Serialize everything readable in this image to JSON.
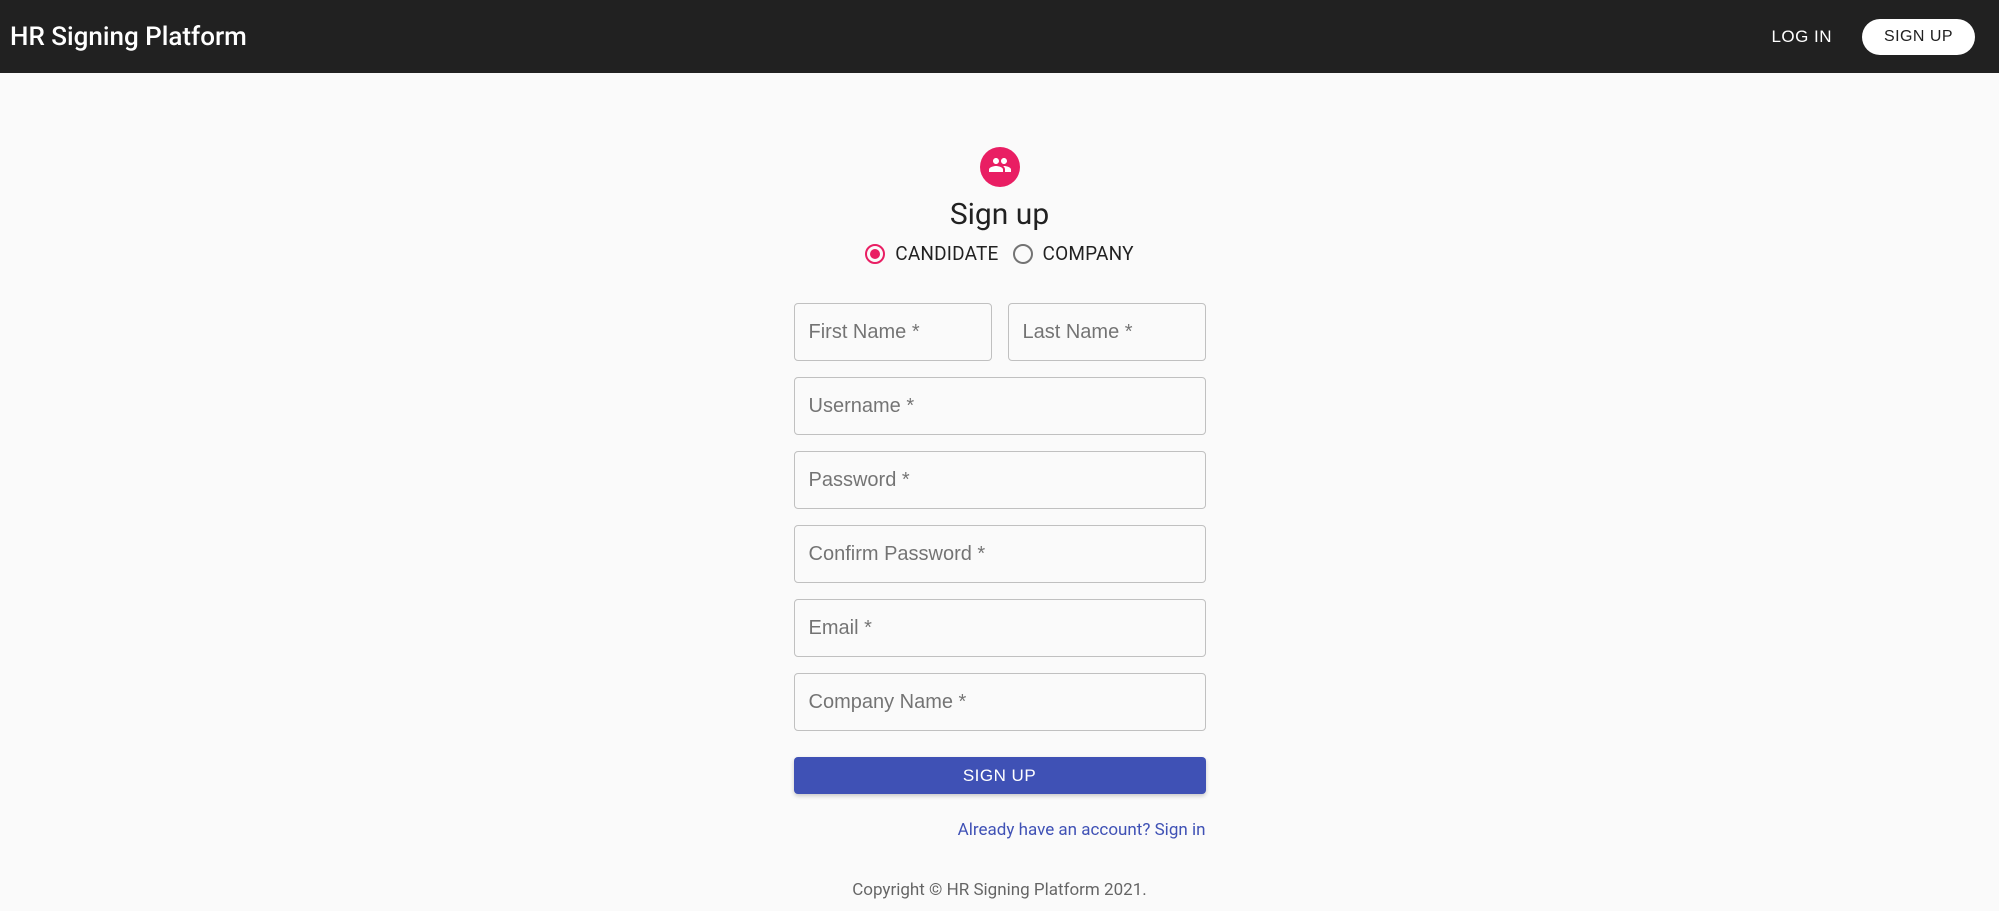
{
  "header": {
    "title": "HR Signing Platform",
    "login_label": "LOG IN",
    "signup_label": "SIGN UP"
  },
  "signup": {
    "heading": "Sign up",
    "role_options": {
      "candidate": "CANDIDATE",
      "company": "COMPANY",
      "selected": "candidate"
    },
    "fields": {
      "first_name": {
        "placeholder": "First Name *",
        "value": ""
      },
      "last_name": {
        "placeholder": "Last Name *",
        "value": ""
      },
      "username": {
        "placeholder": "Username *",
        "value": ""
      },
      "password": {
        "placeholder": "Password *",
        "value": ""
      },
      "confirm_password": {
        "placeholder": "Confirm Password *",
        "value": ""
      },
      "email": {
        "placeholder": "Email *",
        "value": ""
      },
      "company_name": {
        "placeholder": "Company Name *",
        "value": ""
      }
    },
    "submit_label": "SIGN UP",
    "signin_link_text": "Already have an account? Sign in"
  },
  "footer": {
    "copyright": "Copyright © HR Signing Platform 2021."
  },
  "colors": {
    "appbar": "#212121",
    "accent_pink": "#e91e63",
    "primary_blue": "#3f51b5"
  }
}
